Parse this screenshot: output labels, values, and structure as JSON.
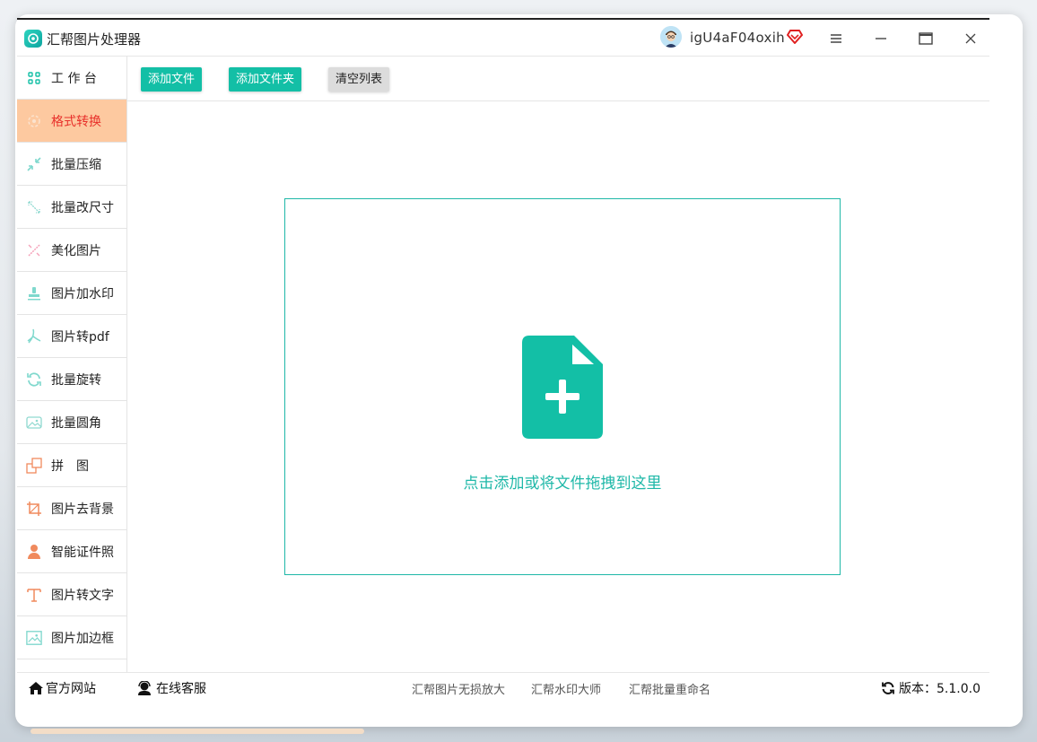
{
  "app": {
    "title": "汇帮图片处理器",
    "username": "igU4aF04oxih"
  },
  "colors": {
    "accent": "#13bfa6",
    "active_bg": "#fdc9a0",
    "active_text": "#e8302a",
    "vip": "#e02020"
  },
  "sidebar": {
    "items": [
      {
        "label": "工 作 台",
        "icon": "grid-icon"
      },
      {
        "label": "格式转换",
        "icon": "convert-icon"
      },
      {
        "label": "批量压缩",
        "icon": "compress-icon"
      },
      {
        "label": "批量改尺寸",
        "icon": "resize-icon"
      },
      {
        "label": "美化图片",
        "icon": "beautify-icon"
      },
      {
        "label": "图片加水印",
        "icon": "stamp-icon"
      },
      {
        "label": "图片转pdf",
        "icon": "pdf-icon"
      },
      {
        "label": "批量旋转",
        "icon": "rotate-icon"
      },
      {
        "label": "批量圆角",
        "icon": "rounded-image-icon"
      },
      {
        "label": "拼　图",
        "icon": "puzzle-icon"
      },
      {
        "label": "图片去背景",
        "icon": "crop-icon"
      },
      {
        "label": "智能证件照",
        "icon": "person-icon"
      },
      {
        "label": "图片转文字",
        "icon": "text-icon"
      },
      {
        "label": "图片加边框",
        "icon": "frame-icon"
      }
    ],
    "active_index": 1
  },
  "toolbar": {
    "add_file": "添加文件",
    "add_folder": "添加文件夹",
    "clear_list": "清空列表"
  },
  "dropzone": {
    "text": "点击添加或将文件拖拽到这里"
  },
  "footer": {
    "website": "官方网站",
    "support": "在线客服",
    "links": [
      "汇帮图片无损放大",
      "汇帮水印大师",
      "汇帮批量重命名"
    ],
    "version": "版本：5.1.0.0"
  }
}
